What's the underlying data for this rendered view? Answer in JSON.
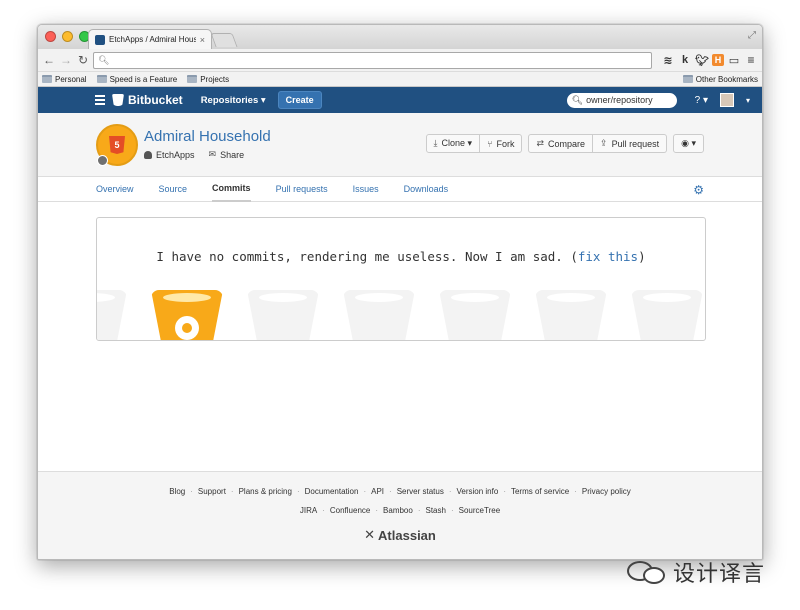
{
  "browser": {
    "tab_title": "EtchApps / Admiral Househ",
    "tab_close": "×",
    "url": "",
    "bookmarks": [
      "Personal",
      "Speed is a Feature",
      "Projects"
    ],
    "other_bookmarks": "Other Bookmarks",
    "extensions": [
      "k",
      "H"
    ]
  },
  "header": {
    "brand": "Bitbucket",
    "repositories": "Repositories ▾",
    "create": "Create",
    "search_placeholder": "owner/repository",
    "help": "? ▾"
  },
  "repo": {
    "title": "Admiral Household",
    "owner": "EtchApps",
    "share": "Share",
    "avatar_badge": "5",
    "actions": {
      "clone": "Clone ▾",
      "fork": "Fork",
      "compare": "Compare",
      "pull_request": "Pull request",
      "watch": "◉ ▾"
    }
  },
  "nav": {
    "tabs": [
      "Overview",
      "Source",
      "Commits",
      "Pull requests",
      "Issues",
      "Downloads"
    ],
    "active": "Commits"
  },
  "empty_state": {
    "message": "I have no commits, rendering me useless. Now I am sad. (",
    "link": "fix this",
    "suffix": ")"
  },
  "footer": {
    "row1": [
      "Blog",
      "Support",
      "Plans & pricing",
      "Documentation",
      "API",
      "Server status",
      "Version info",
      "Terms of service",
      "Privacy policy"
    ],
    "row2": [
      "JIRA",
      "Confluence",
      "Bamboo",
      "Stash",
      "SourceTree"
    ],
    "brand": "Atlassian"
  },
  "watermark": {
    "text": "设计译言"
  },
  "colors": {
    "header_bg": "#205081",
    "link": "#3572b0",
    "bucket_gold": "#f8a919"
  }
}
